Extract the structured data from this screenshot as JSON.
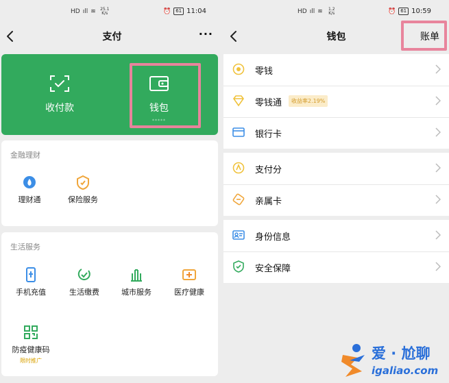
{
  "left": {
    "status": {
      "network_speed": "25.1 K/s",
      "battery": "61",
      "time": "11:04"
    },
    "nav": {
      "title": "支付"
    },
    "pay_card": {
      "collect_label": "收付款",
      "wallet_label": "钱包",
      "wallet_balance_hidden": "*****"
    },
    "finance": {
      "title": "金融理财",
      "items": [
        {
          "label": "理财通",
          "icon": "licaitong-icon"
        },
        {
          "label": "保险服务",
          "icon": "insurance-icon"
        }
      ]
    },
    "life": {
      "title": "生活服务",
      "items": [
        {
          "label": "手机充值",
          "icon": "phone-recharge-icon"
        },
        {
          "label": "生活缴费",
          "icon": "utility-payment-icon"
        },
        {
          "label": "城市服务",
          "icon": "city-service-icon"
        },
        {
          "label": "医疗健康",
          "icon": "medical-icon"
        },
        {
          "label": "防疫健康码",
          "icon": "qr-code-icon",
          "sub": "限时推广"
        }
      ]
    }
  },
  "right": {
    "status": {
      "network_speed": "1.2 K/s",
      "battery": "61",
      "time": "10:59"
    },
    "nav": {
      "title": "钱包",
      "action": "账单"
    },
    "group1": [
      {
        "label": "零钱",
        "icon": "coin-icon"
      },
      {
        "label": "零钱通",
        "icon": "diamond-icon",
        "badge": "收益率2.19%"
      },
      {
        "label": "银行卡",
        "icon": "bank-card-icon"
      }
    ],
    "group2": [
      {
        "label": "支付分",
        "icon": "pay-score-icon"
      },
      {
        "label": "亲属卡",
        "icon": "family-card-icon"
      }
    ],
    "group3": [
      {
        "label": "身份信息",
        "icon": "id-card-icon"
      },
      {
        "label": "安全保障",
        "icon": "shield-icon"
      }
    ]
  },
  "watermark": {
    "title": "爱 · 尬聊",
    "url": "igaliao.com"
  },
  "colors": {
    "wechat_green": "#32aa5d",
    "highlight": "#e8849c",
    "icon_yellow": "#f0c23b",
    "icon_blue": "#3c8ee6",
    "watermark_blue": "#2a6fd9",
    "watermark_orange": "#f08a2a"
  }
}
